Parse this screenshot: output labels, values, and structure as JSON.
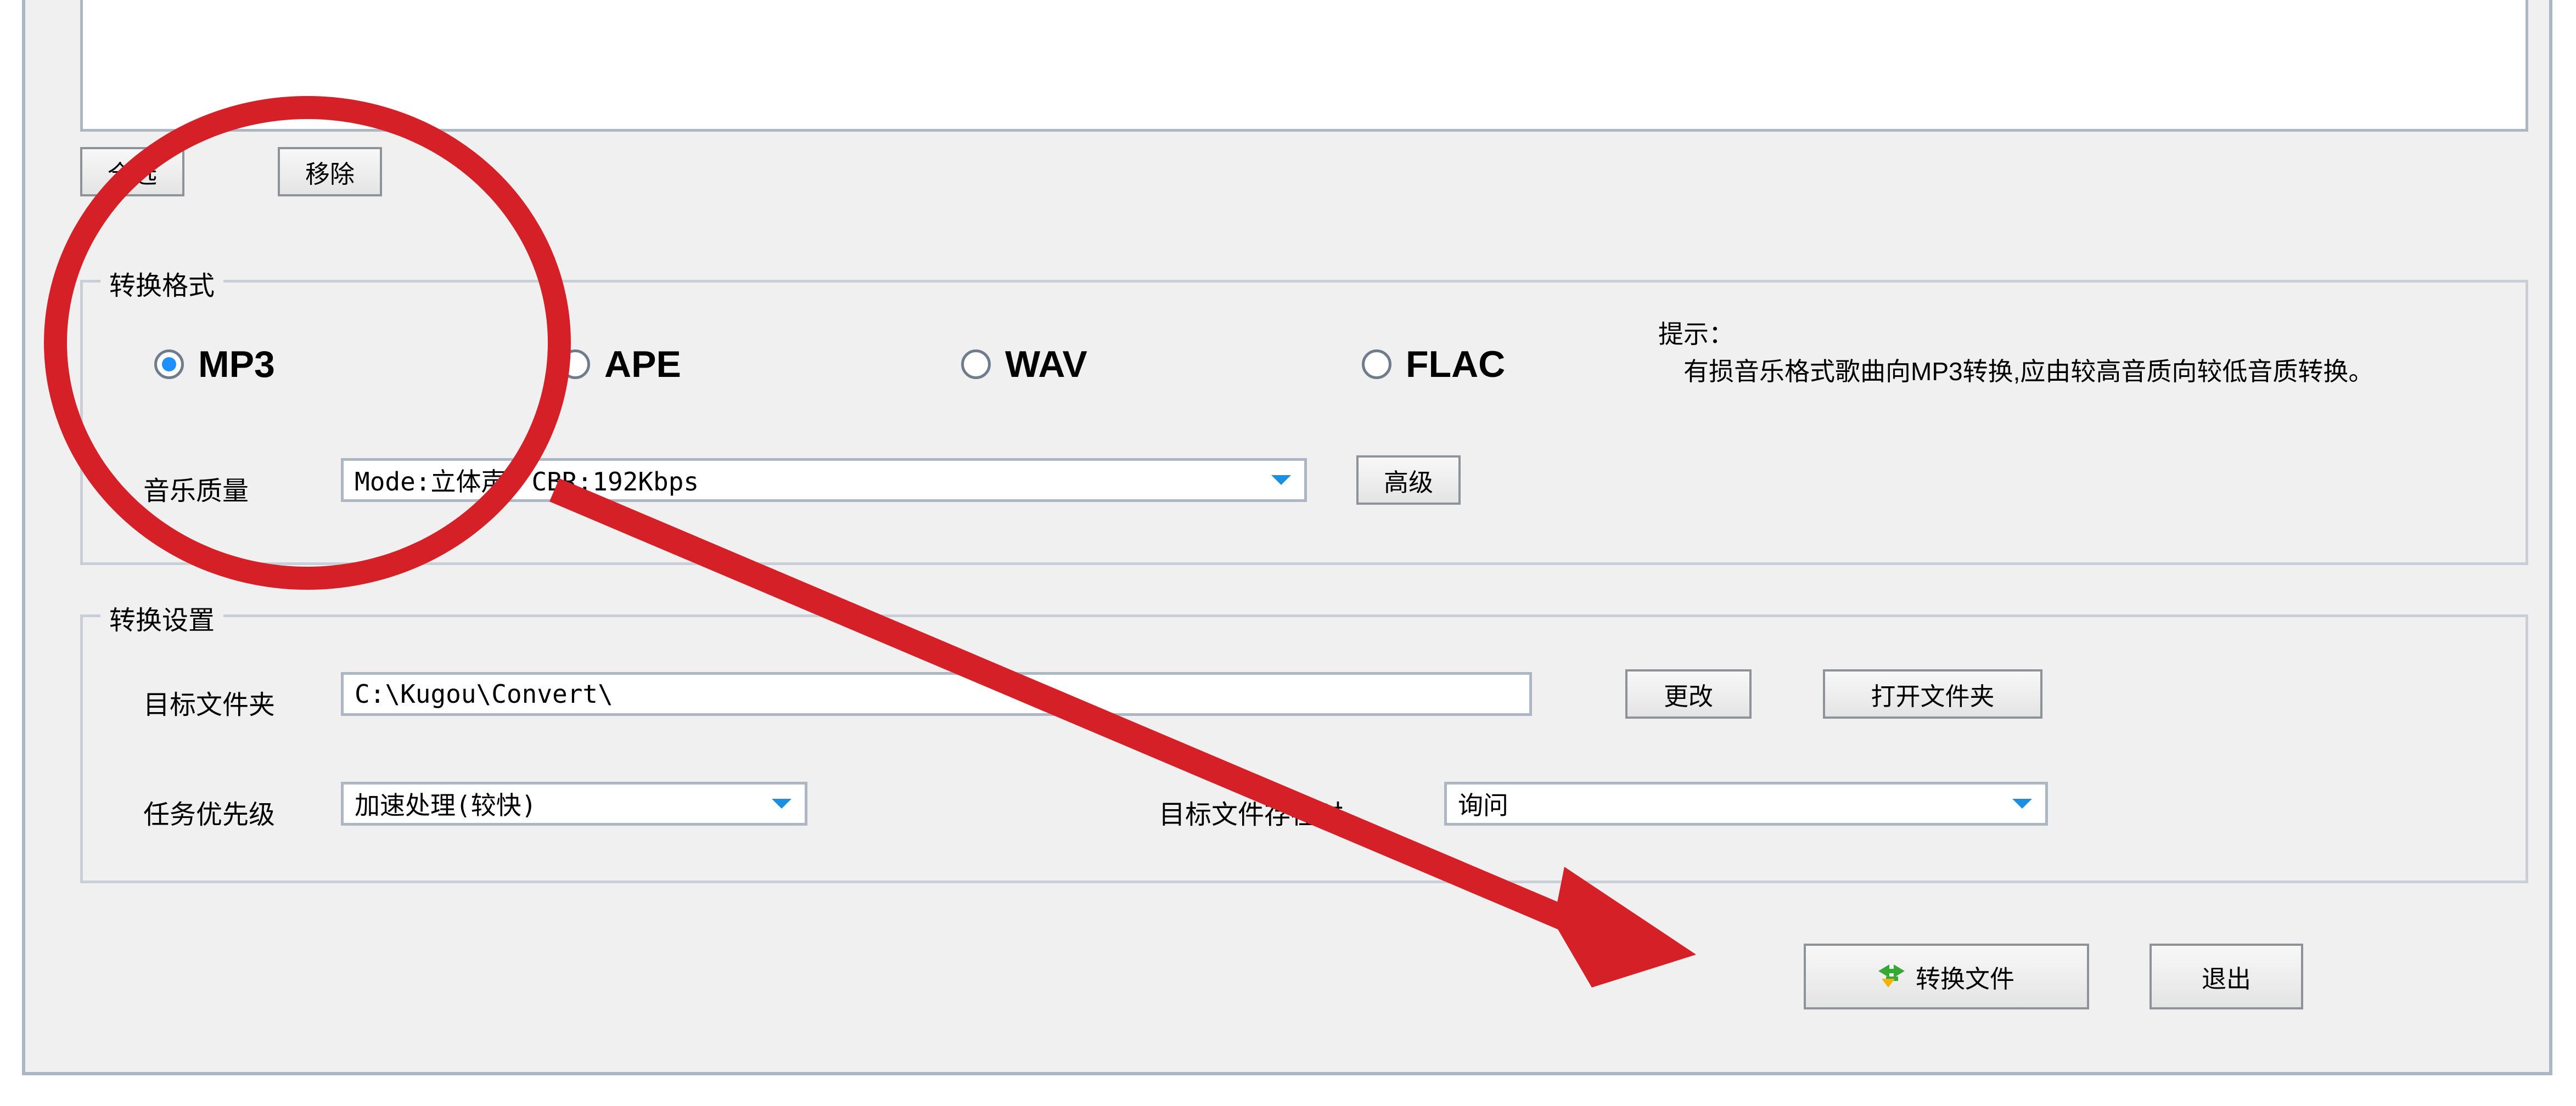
{
  "toolbar": {
    "select_all_label": "全选",
    "remove_label": "移除"
  },
  "format_group": {
    "legend": "转换格式",
    "options": {
      "mp3": "MP3",
      "ape": "APE",
      "wav": "WAV",
      "flac": "FLAC"
    },
    "selected": "mp3",
    "quality_label": "音乐质量",
    "quality_value": "Mode:立体声；CBR:192Kbps",
    "advanced_label": "高级",
    "hint_title": "提示：",
    "hint_body": "　有损音乐格式歌曲向MP3转换,应由较高音质向较低音质转换。"
  },
  "settings_group": {
    "legend": "转换设置",
    "dest_label": "目标文件夹",
    "dest_value": "C:\\Kugou\\Convert\\",
    "change_label": "更改",
    "open_folder_label": "打开文件夹",
    "priority_label": "任务优先级",
    "priority_value": "加速处理(较快)",
    "exists_label": "目标文件存在时",
    "exists_value": "询问"
  },
  "actions": {
    "convert_label": "转换文件",
    "exit_label": "退出"
  }
}
